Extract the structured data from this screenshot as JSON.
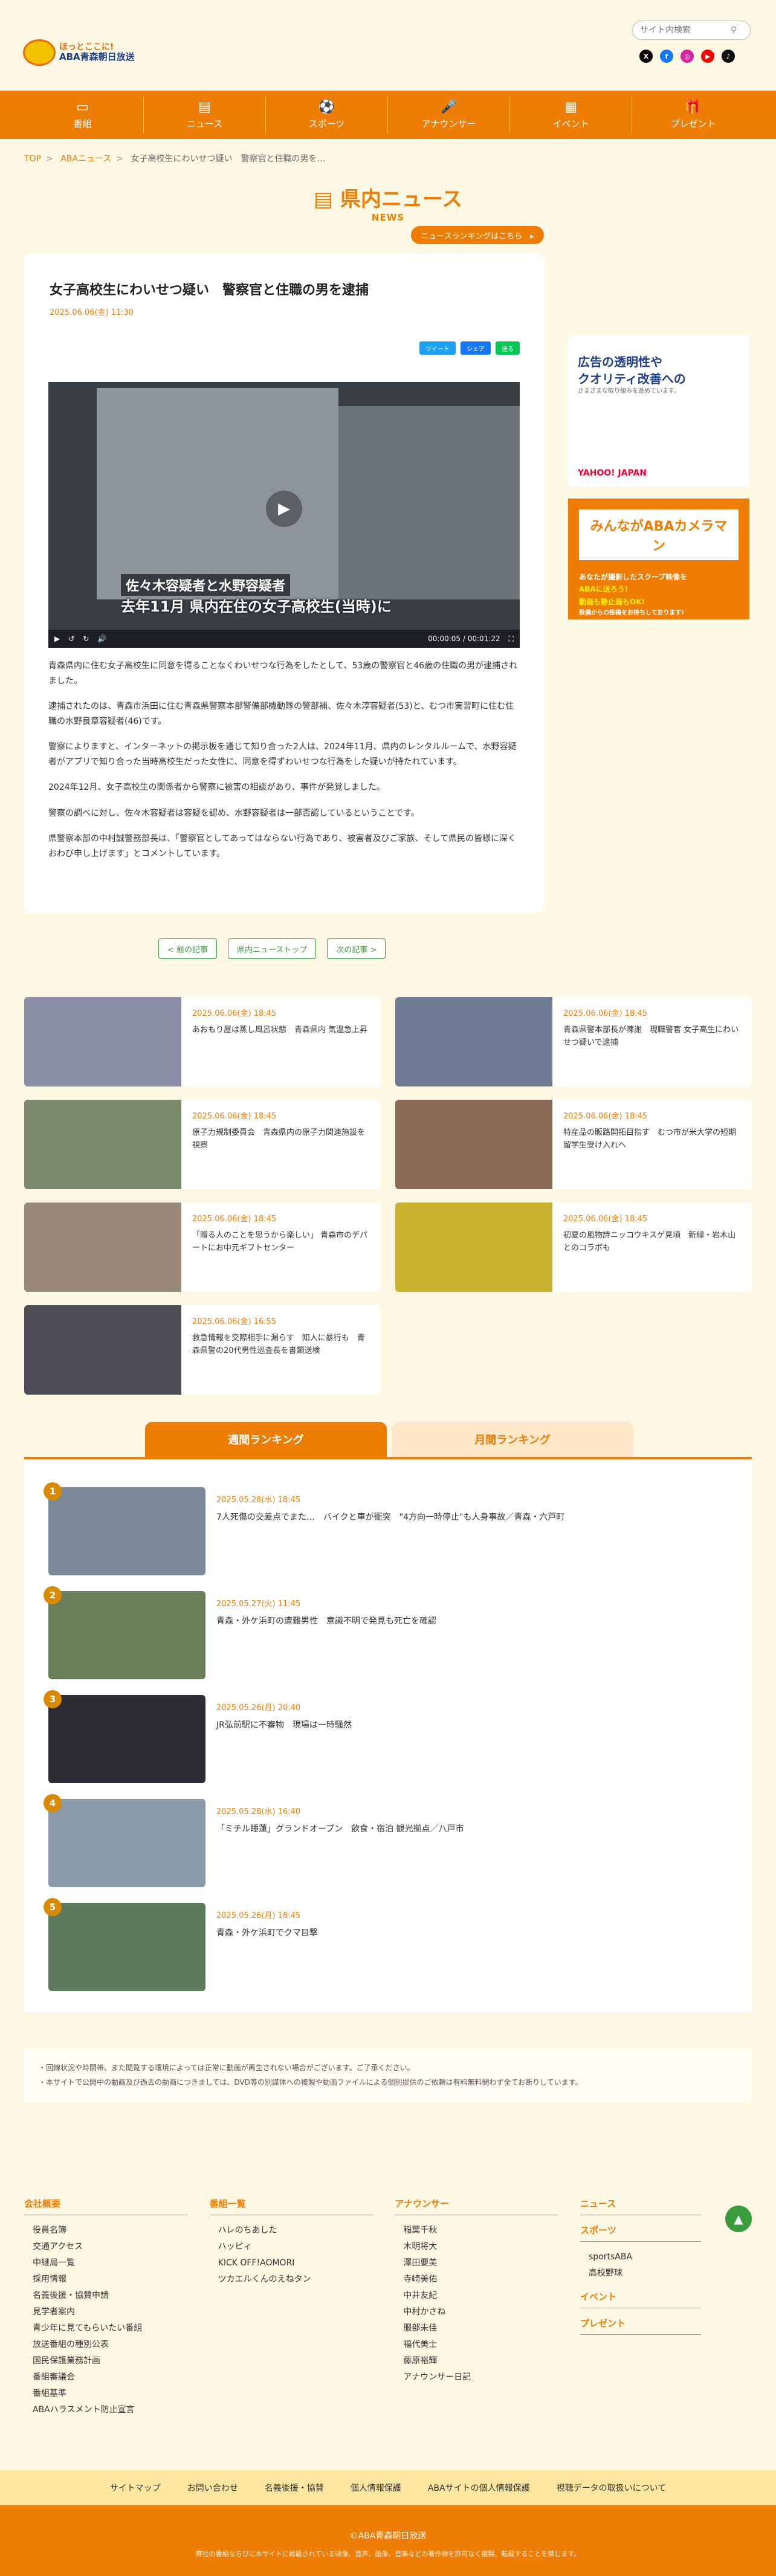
{
  "header": {
    "logo_line1": "ほっとここに!",
    "logo_line2": "ABA青森朝日放送",
    "search_placeholder": "サイト内検索",
    "search_icon": "search-icon"
  },
  "social": [
    {
      "name": "x-icon",
      "label": "X",
      "color": "#000000"
    },
    {
      "name": "facebook-icon",
      "label": "f",
      "color": "#1877f2"
    },
    {
      "name": "instagram-icon",
      "label": "◎",
      "color": "#d6249f"
    },
    {
      "name": "youtube-icon",
      "label": "▶",
      "color": "#ff0000"
    },
    {
      "name": "tiktok-icon",
      "label": "♪",
      "color": "#111111"
    }
  ],
  "nav": [
    {
      "icon": "▭",
      "label": "番組"
    },
    {
      "icon": "▤",
      "label": "ニュース"
    },
    {
      "icon": "⚽",
      "label": "スポーツ"
    },
    {
      "icon": "🎤",
      "label": "アナウンサー"
    },
    {
      "icon": "▦",
      "label": "イベント"
    },
    {
      "icon": "🎁",
      "label": "プレゼント"
    }
  ],
  "breadcrumb": [
    "TOP",
    "ABAニュース",
    "女子高校生にわいせつ疑い　警察官と住職の男を…"
  ],
  "section": {
    "title": "県内ニュース",
    "en": "NEWS",
    "ranking_link": "ニュースランキングはこちら　▸"
  },
  "article": {
    "title": "女子高校生にわいせつ疑い　警察官と住職の男を逮捕",
    "date": "2025.06.06(金) 11:30",
    "share": [
      "ツイート",
      "シェア",
      "送る"
    ],
    "video_caption1": "佐々木容疑者と水野容疑者",
    "video_caption2": "去年11月 県内在住の女子高校生(当時)に",
    "video_time": "00:00:05 / 00:01:22",
    "paragraphs": [
      "青森県内に住む女子高校生に同意を得ることなくわいせつな行為をしたとして、53歳の警察官と46歳の住職の男が逮捕されました。",
      "逮捕されたのは、青森市浜田に住む青森県警察本部警備部機動隊の警部補、佐々木淳容疑者(53)と、むつ市実習町に住む住職の水野良章容疑者(46)です。",
      "警察によりますと、インターネットの掲示板を通じて知り合った2人は、2024年11月、県内のレンタルルームで、水野容疑者がアプリで知り合った当時高校生だった女性に、同意を得ずわいせつな行為をした疑いが持たれています。",
      "2024年12月、女子高校生の関係者から警察に被害の相談があり、事件が発覚しました。",
      "警察の調べに対し、佐々木容疑者は容疑を認め、水野容疑者は一部否認しているということです。",
      "県警察本部の中村誠警務部長は、「警察官としてあってはならない行為であり、被害者及びご家族、そして県民の皆様に深くおわび申し上げます」とコメントしています。"
    ]
  },
  "pager": [
    "< 前の記事",
    "県内ニューストップ",
    "次の記事 >"
  ],
  "ads": {
    "ad1_line1": "広告の透明性や",
    "ad1_line2": "クオリティ改善への",
    "ad1_line3": "さまざまな取り組みを進めています。",
    "ad1_brand": "YAHOO! JAPAN",
    "ad2_title": "みんながABAカメラマン",
    "ad2_line1": "あなたが撮影したスクープ映像を",
    "ad2_line2": "ABAに送ろう!",
    "ad2_line3": "動画も静止画もOK!",
    "ad2_line4": "投稿からの投稿をお待ちしております!"
  },
  "cards": [
    {
      "date": "2025.06.06(金) 18:45",
      "title": "あおもり屋は蒸し風呂状態　青森県内 気温急上昇",
      "color": "#8c8fa8"
    },
    {
      "date": "2025.06.06(金) 18:45",
      "title": "青森県警本部長が陳謝　現職警官 女子高生にわいせつ疑いで逮捕",
      "color": "#6f7a93"
    },
    {
      "date": "2025.06.06(金) 18:45",
      "title": "原子力規制委員会　青森県内の原子力関連施設を視察",
      "color": "#7a8a6a"
    },
    {
      "date": "2025.06.06(金) 18:45",
      "title": "特産品の販路開拓目指す　むつ市が米大学の短期留学生受け入れへ",
      "color": "#8b6a5a"
    },
    {
      "date": "2025.06.06(金) 18:45",
      "title": "「贈る人のことを思うから楽しい」 青森市のデパートにお中元ギフトセンター",
      "color": "#9a8a7a"
    },
    {
      "date": "2025.06.06(金) 18:45",
      "title": "初夏の風物詩ニッコウキスゲ見頃　新緑・岩木山とのコラボも",
      "color": "#c9b230"
    },
    {
      "date": "2025.06.06(金) 16:55",
      "title": "救急情報を交際相手に漏らす　知人に暴行も　青森県警の20代男性巡査長を書類送検",
      "color": "#4d4d55"
    }
  ],
  "ranking": {
    "tabs": [
      "週間ランキング",
      "月間ランキング"
    ],
    "items": [
      {
        "num": "1",
        "date": "2025.05.28(水) 18:45",
        "title": "7人死傷の交差点でまた…　バイクと車が衝突　\"4方向一時停止\"も人身事故／青森・六戸町",
        "color": "#7b8a96"
      },
      {
        "num": "2",
        "date": "2025.05.27(火) 11:45",
        "title": "青森・外ケ浜町の遭難男性　意識不明で発見も死亡を確認",
        "color": "#6a7d5a"
      },
      {
        "num": "3",
        "date": "2025.05.26(月) 20:40",
        "title": "JR弘前駅に不審物　現場は一時騒然",
        "color": "#2d2d33"
      },
      {
        "num": "4",
        "date": "2025.05.28(水) 16:40",
        "title": "「ミチル睡蓮」グランドオープン　飲食・宿泊 観光拠点／八戸市",
        "color": "#8a9aa8"
      },
      {
        "num": "5",
        "date": "2025.05.26(月) 18:45",
        "title": "青森・外ケ浜町でクマ目撃",
        "color": "#5c7a5c"
      }
    ]
  },
  "notice": [
    "・回線状況や時間帯、また閲覧する環境によっては正常に動画が再生されない場合がございます。ご了承ください。",
    "・本サイトで公開中の動画及び過去の動画につきましては、DVD等の別媒体への複製や動画ファイルによる個別提供のご依頼は有料無料問わず全てお断りしています。"
  ],
  "footer": {
    "col1": {
      "title": "会社概要",
      "items": [
        "役員名簿",
        "交通アクセス",
        "中継局一覧",
        "採用情報",
        "名義後援・協賛申請",
        "見学者案内",
        "青少年に見てもらいたい番組",
        "放送番組の種別公表",
        "国民保護業務計画",
        "番組審議会",
        "番組基準",
        "ABAハラスメント防止宣言"
      ]
    },
    "col2": {
      "title": "番組一覧",
      "items": [
        "ハレのちあした",
        "ハッピィ",
        "KICK OFF!AOMORI",
        "ツカエルくんのえねタン"
      ]
    },
    "col3": {
      "title": "アナウンサー",
      "items": [
        "稲葉千秋",
        "木明将大",
        "澤田要美",
        "寺崎美佑",
        "中井友紀",
        "中村かさね",
        "服部未佳",
        "福代美士",
        "藤原裕輝",
        "アナウンサー日記"
      ]
    },
    "col4": {
      "title": "ニュース",
      "sub1": "スポーツ",
      "sub1_items": [
        "sportsABA",
        "高校野球"
      ],
      "sub2": "イベント",
      "sub3": "プレゼント"
    },
    "bar": [
      "サイトマップ",
      "お問い合わせ",
      "名義後援・協賛",
      "個人情報保護",
      "ABAサイトの個人情報保護",
      "視聴データの取扱いについて"
    ],
    "copyright": "©ABA青森朝日放送",
    "small": "弊社の番組ならびに本サイトに掲載されている映像、音声、画像、音楽などの著作物を許可なく複製、転載することを禁じます。"
  }
}
